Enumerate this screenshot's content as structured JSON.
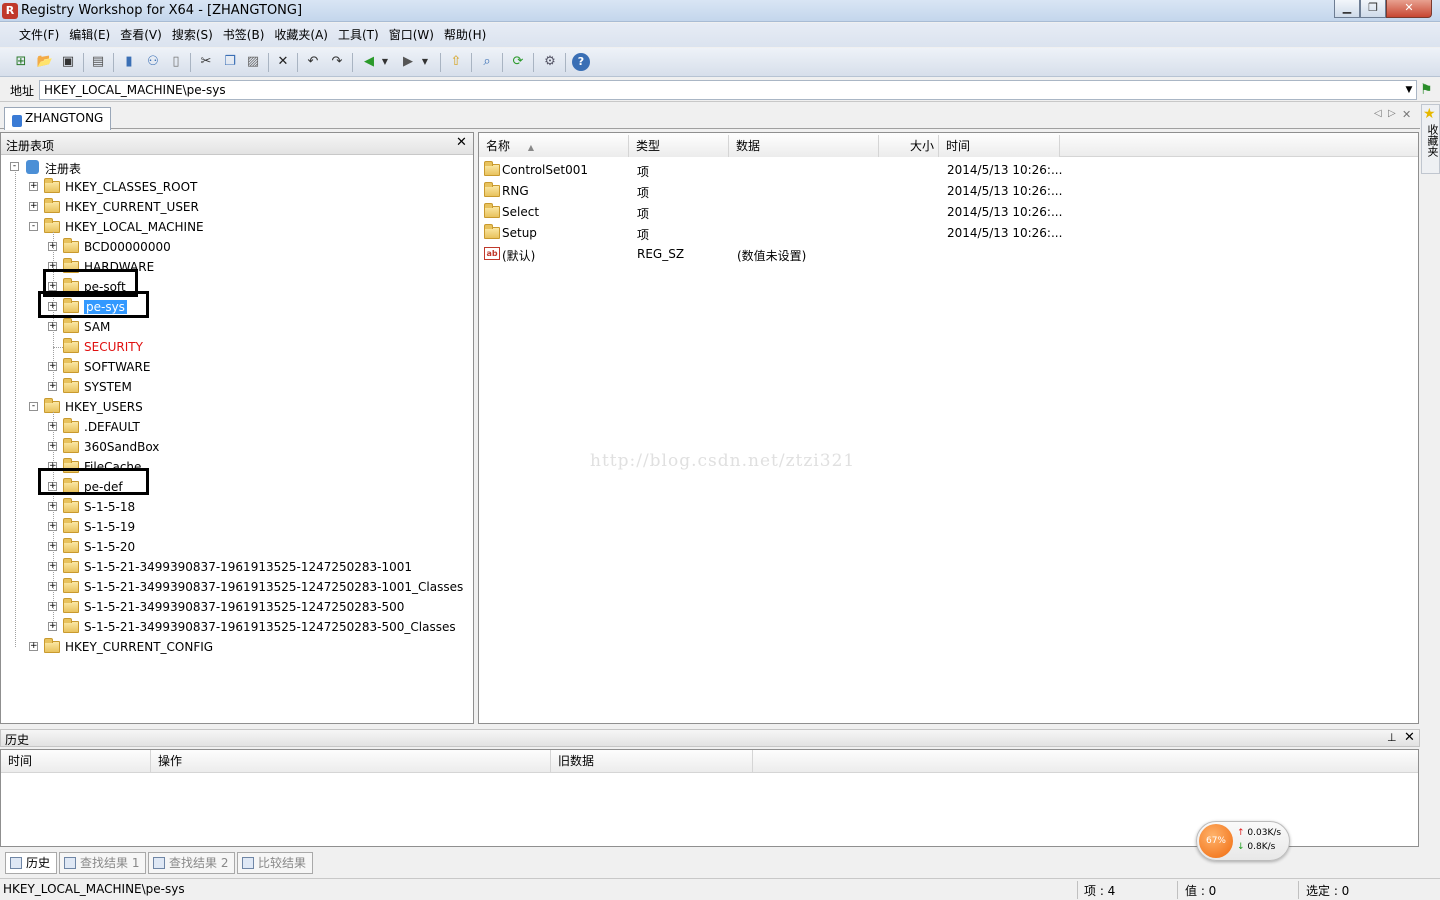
{
  "window": {
    "title": "Registry Workshop for X64 - [ZHANGTONG]",
    "app_icon": "registry-workshop-icon",
    "minimize": "▁",
    "maximize": "❐",
    "close": "✕"
  },
  "menu": [
    "文件(F)",
    "编辑(E)",
    "查看(V)",
    "搜索(S)",
    "书签(B)",
    "收藏夹(A)",
    "工具(T)",
    "窗口(W)",
    "帮助(H)"
  ],
  "toolbar_icons": [
    "connect-registry-icon",
    "open-icon",
    "save-icon",
    "print-icon",
    "registry-icon",
    "network-icon",
    "export-icon",
    "cut-icon",
    "copy-icon",
    "paste-icon",
    "delete-icon",
    "undo-icon",
    "redo-icon",
    "back-icon",
    "back-dropdown-icon",
    "forward-icon",
    "forward-dropdown-icon",
    "up-level-icon",
    "find-icon",
    "refresh-icon",
    "options-icon",
    "help-icon"
  ],
  "address": {
    "label": "地址",
    "value": "HKEY_LOCAL_MACHINE\\pe-sys"
  },
  "doc_tab": "ZHANGTONG",
  "right_dock": "收藏夹",
  "tree": {
    "header": "注册表项",
    "root": "注册表",
    "nodes": [
      {
        "label": "HKEY_CLASSES_ROOT",
        "level": 1,
        "expander": "+"
      },
      {
        "label": "HKEY_CURRENT_USER",
        "level": 1,
        "expander": "+"
      },
      {
        "label": "HKEY_LOCAL_MACHINE",
        "level": 1,
        "expander": "-"
      },
      {
        "label": "BCD00000000",
        "level": 2,
        "expander": "+"
      },
      {
        "label": "HARDWARE",
        "level": 2,
        "expander": "+"
      },
      {
        "label": "pe-soft",
        "level": 2,
        "expander": "+",
        "annotated": true
      },
      {
        "label": "pe-sys",
        "level": 2,
        "expander": "+",
        "selected": true,
        "annotated": true
      },
      {
        "label": "SAM",
        "level": 2,
        "expander": "+"
      },
      {
        "label": "SECURITY",
        "level": 2,
        "expander": "",
        "red": true
      },
      {
        "label": "SOFTWARE",
        "level": 2,
        "expander": "+"
      },
      {
        "label": "SYSTEM",
        "level": 2,
        "expander": "+"
      },
      {
        "label": "HKEY_USERS",
        "level": 1,
        "expander": "-"
      },
      {
        "label": ".DEFAULT",
        "level": 2,
        "expander": "+"
      },
      {
        "label": "360SandBox",
        "level": 2,
        "expander": "+"
      },
      {
        "label": "FileCache",
        "level": 2,
        "expander": "+"
      },
      {
        "label": "pe-def",
        "level": 2,
        "expander": "+",
        "annotated": true
      },
      {
        "label": "S-1-5-18",
        "level": 2,
        "expander": "+"
      },
      {
        "label": "S-1-5-19",
        "level": 2,
        "expander": "+"
      },
      {
        "label": "S-1-5-20",
        "level": 2,
        "expander": "+"
      },
      {
        "label": "S-1-5-21-3499390837-1961913525-1247250283-1001",
        "level": 2,
        "expander": "+"
      },
      {
        "label": "S-1-5-21-3499390837-1961913525-1247250283-1001_Classes",
        "level": 2,
        "expander": "+"
      },
      {
        "label": "S-1-5-21-3499390837-1961913525-1247250283-500",
        "level": 2,
        "expander": "+"
      },
      {
        "label": "S-1-5-21-3499390837-1961913525-1247250283-500_Classes",
        "level": 2,
        "expander": "+"
      },
      {
        "label": "HKEY_CURRENT_CONFIG",
        "level": 1,
        "expander": "+"
      }
    ]
  },
  "list": {
    "columns": [
      "名称",
      "类型",
      "数据",
      "大小",
      "时间"
    ],
    "sort_indicator": "▲",
    "rows": [
      {
        "name": "ControlSet001",
        "type": "项",
        "data": "",
        "size": "",
        "time": "2014/5/13 10:26:...",
        "icon": "folder-icon"
      },
      {
        "name": "RNG",
        "type": "项",
        "data": "",
        "size": "",
        "time": "2014/5/13 10:26:...",
        "icon": "folder-icon"
      },
      {
        "name": "Select",
        "type": "项",
        "data": "",
        "size": "",
        "time": "2014/5/13 10:26:...",
        "icon": "folder-icon"
      },
      {
        "name": "Setup",
        "type": "项",
        "data": "",
        "size": "",
        "time": "2014/5/13 10:26:...",
        "icon": "folder-icon"
      },
      {
        "name": "(默认)",
        "type": "REG_SZ",
        "data": "(数值未设置)",
        "size": "",
        "time": "",
        "icon": "string-value-icon"
      }
    ]
  },
  "watermark": "http://blog.csdn.net/ztzi321",
  "history": {
    "title": "历史",
    "pin": "📌",
    "close": "✕",
    "columns": [
      "时间",
      "操作",
      "旧数据"
    ]
  },
  "bottom_tabs": [
    {
      "label": "历史",
      "active": true
    },
    {
      "label": "查找结果 1",
      "active": false
    },
    {
      "label": "查找结果 2",
      "active": false
    },
    {
      "label": "比较结果",
      "active": false
    }
  ],
  "net_widget": {
    "percent": "67%",
    "up": "0.03K/s",
    "down": "0.8K/s",
    "up_color": "#e02020",
    "down_color": "#20a020"
  },
  "status": {
    "path": "HKEY_LOCAL_MACHINE\\pe-sys",
    "items": "项 : 4",
    "values": "值 : 0",
    "selected": "选定 : 0"
  }
}
